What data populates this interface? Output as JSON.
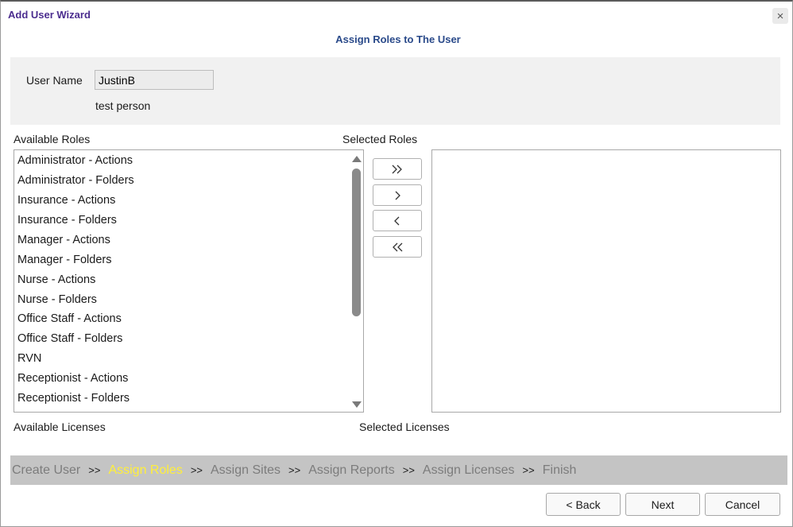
{
  "window": {
    "title": "Add User Wizard",
    "close_glyph": "×"
  },
  "page": {
    "subtitle": "Assign Roles to The User"
  },
  "user": {
    "label": "User Name",
    "value": "JustinB",
    "description": "test person"
  },
  "available_roles": {
    "label": "Available Roles",
    "items": [
      "Administrator - Actions",
      "Administrator - Folders",
      "Insurance - Actions",
      "Insurance - Folders",
      "Manager - Actions",
      "Manager - Folders",
      "Nurse - Actions",
      "Nurse - Folders",
      "Office Staff - Actions",
      "Office Staff - Folders",
      "RVN",
      "Receptionist - Actions",
      "Receptionist - Folders"
    ]
  },
  "selected_roles": {
    "label": "Selected Roles",
    "items": []
  },
  "move_buttons": {
    "add_all": "»",
    "add": "›",
    "remove": "‹",
    "remove_all": "«"
  },
  "licenses": {
    "available_label": "Available Licenses",
    "selected_label": "Selected Licenses"
  },
  "steps": [
    {
      "label": "Create User",
      "active": false
    },
    {
      "label": "Assign Roles",
      "active": true
    },
    {
      "label": "Assign Sites",
      "active": false
    },
    {
      "label": "Assign Reports",
      "active": false
    },
    {
      "label": "Assign Licenses",
      "active": false
    },
    {
      "label": "Finish",
      "active": false
    }
  ],
  "step_separator": ">>",
  "footer": {
    "back": "< Back",
    "next": "Next",
    "cancel": "Cancel"
  },
  "colors": {
    "title": "#4b2d8f",
    "subtitle": "#2a4a8a",
    "active_step": "#ffef3a",
    "inactive_step": "#7c7c7c",
    "steps_bar": "#c4c4c4"
  }
}
